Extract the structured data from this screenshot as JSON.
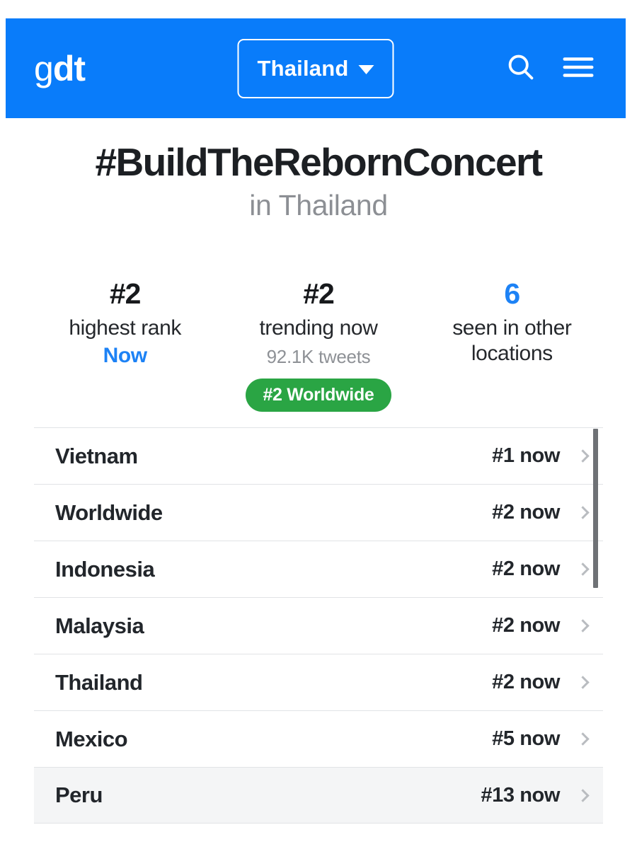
{
  "header": {
    "logo_g": "g",
    "logo_dt": "dt",
    "region_label": "Thailand",
    "search_icon": "search-icon",
    "menu_icon": "hamburger-menu-icon",
    "caret_icon": "chevron-down-icon",
    "background_color": "#097cfa"
  },
  "hero": {
    "title": "#BuildTheRebornConcert",
    "subtitle": "in Thailand"
  },
  "stats": [
    {
      "value": "#2",
      "label": "highest rank",
      "note": "Now",
      "value_accent": false
    },
    {
      "value": "#2",
      "label": "trending now",
      "sub": "92.1K tweets",
      "badge": "#2 Worldwide",
      "value_accent": false
    },
    {
      "value": "6",
      "label": "seen in other locations",
      "value_accent": true
    }
  ],
  "locations": [
    {
      "name": "Vietnam",
      "rank": "#1 now",
      "active": false
    },
    {
      "name": "Worldwide",
      "rank": "#2 now",
      "active": false
    },
    {
      "name": "Indonesia",
      "rank": "#2 now",
      "active": false
    },
    {
      "name": "Malaysia",
      "rank": "#2 now",
      "active": false
    },
    {
      "name": "Thailand",
      "rank": "#2 now",
      "active": false
    },
    {
      "name": "Mexico",
      "rank": "#5 now",
      "active": false
    },
    {
      "name": "Peru",
      "rank": "#13 now",
      "active": true
    }
  ],
  "colors": {
    "brand_blue": "#097cfa",
    "accent_blue": "#1d82f5",
    "badge_green": "#2aa544",
    "text_dark": "#22262b",
    "text_muted": "#8e9196"
  }
}
